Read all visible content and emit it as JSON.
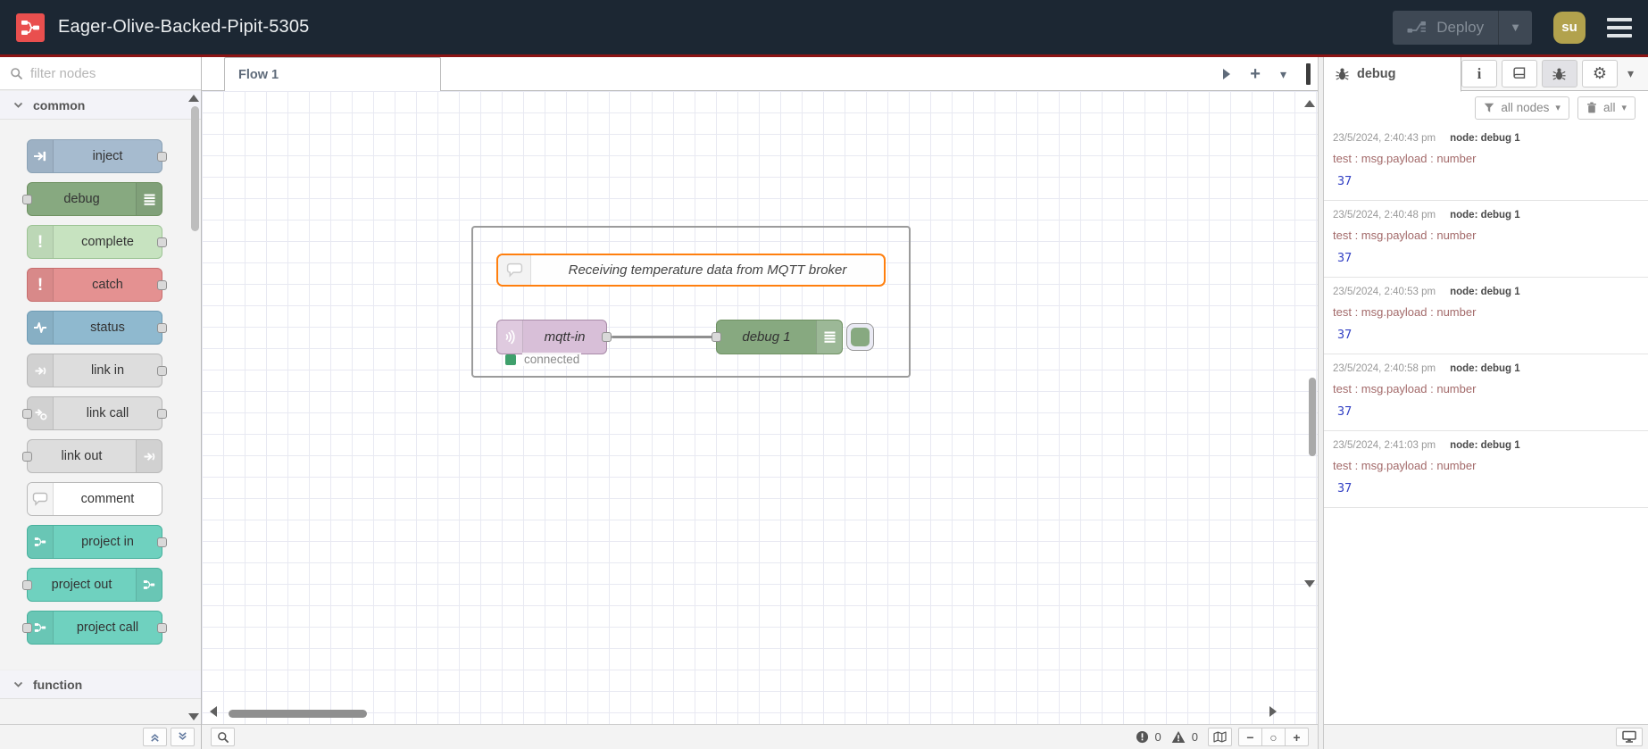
{
  "colors": {
    "header_bg": "#1c2733",
    "logo_red": "#e94f4e",
    "header_accent_line": "#8c1414",
    "deploy_bg": "#3e4854",
    "avatar_bg": "#b2a24d",
    "selection_orange": "#ff7f0e",
    "status_green": "#3fa06c",
    "wire_gray": "#8f8f8f",
    "grid_line": "#e8e9f2",
    "node_inject": "#a6bbcf",
    "node_debug": "#87a980",
    "node_complete": "#c7e3c0",
    "node_catch": "#e49191",
    "node_status": "#8fb9cf",
    "node_link": "#dddddd",
    "node_comment": "#ffffff",
    "node_project": "#6fd1bf",
    "node_mqtt": "#d8bfd8",
    "debug_value_blue": "#3341c4",
    "debug_property_red": "#a36a6a"
  },
  "header": {
    "title": "Eager-Olive-Backed-Pipit-5305",
    "deploy_label": "Deploy",
    "avatar_initials": "su"
  },
  "palette": {
    "filter_placeholder": "filter nodes",
    "categories": [
      {
        "label": "common"
      },
      {
        "label": "function"
      }
    ],
    "nodes": [
      {
        "label": "inject"
      },
      {
        "label": "debug"
      },
      {
        "label": "complete"
      },
      {
        "label": "catch"
      },
      {
        "label": "status"
      },
      {
        "label": "link in"
      },
      {
        "label": "link call"
      },
      {
        "label": "link out"
      },
      {
        "label": "comment"
      },
      {
        "label": "project in"
      },
      {
        "label": "project out"
      },
      {
        "label": "project call"
      }
    ]
  },
  "workspace": {
    "tab_label": "Flow 1",
    "comment_text": "Receiving temperature data from MQTT broker",
    "mqtt_node_label": "mqtt-in",
    "debug_node_label": "debug 1",
    "status_text": "connected",
    "footer": {
      "error_count": "0",
      "warning_count": "0",
      "zoom_out": "−",
      "zoom_reset": "○",
      "zoom_in": "+"
    }
  },
  "sidebar": {
    "tab_label": "debug",
    "filter_label": "all nodes",
    "clear_label": "all",
    "messages": [
      {
        "timestamp": "23/5/2024, 2:40:43 pm",
        "source": "node: debug 1",
        "property": "test : msg.payload : number",
        "value": "37"
      },
      {
        "timestamp": "23/5/2024, 2:40:48 pm",
        "source": "node: debug 1",
        "property": "test : msg.payload : number",
        "value": "37"
      },
      {
        "timestamp": "23/5/2024, 2:40:53 pm",
        "source": "node: debug 1",
        "property": "test : msg.payload : number",
        "value": "37"
      },
      {
        "timestamp": "23/5/2024, 2:40:58 pm",
        "source": "node: debug 1",
        "property": "test : msg.payload : number",
        "value": "37"
      },
      {
        "timestamp": "23/5/2024, 2:41:03 pm",
        "source": "node: debug 1",
        "property": "test : msg.payload : number",
        "value": "37"
      }
    ]
  },
  "icons": {
    "caret_down": "▾",
    "gear": "⚙",
    "info": "i"
  }
}
